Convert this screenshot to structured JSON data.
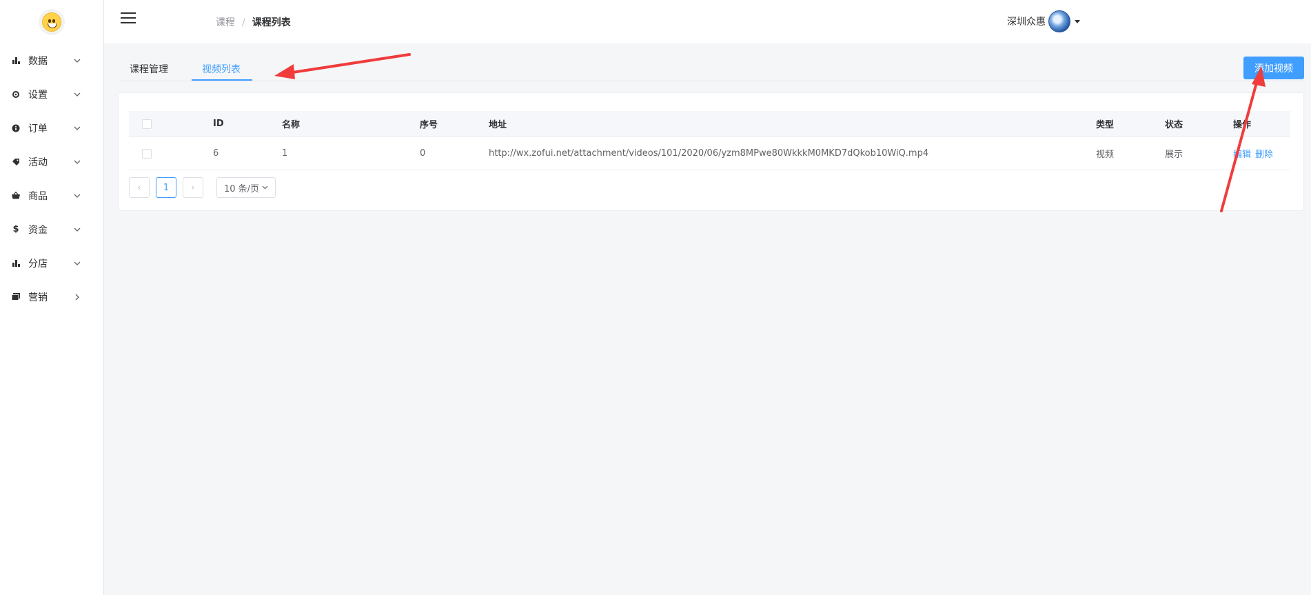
{
  "sidebar": {
    "items": [
      {
        "label": "数据",
        "icon": "bar-chart-icon",
        "arrow": "chevron-down-icon"
      },
      {
        "label": "设置",
        "icon": "gear-icon",
        "arrow": "chevron-down-icon"
      },
      {
        "label": "订单",
        "icon": "info-circle-icon",
        "arrow": "chevron-down-icon"
      },
      {
        "label": "活动",
        "icon": "tag-icon",
        "arrow": "chevron-down-icon"
      },
      {
        "label": "商品",
        "icon": "basket-icon",
        "arrow": "chevron-down-icon"
      },
      {
        "label": "资金",
        "icon": "dollar-icon",
        "arrow": "chevron-down-icon"
      },
      {
        "label": "分店",
        "icon": "bar-chart-icon",
        "arrow": "chevron-down-icon"
      },
      {
        "label": "营销",
        "icon": "stack-icon",
        "arrow": "chevron-right-icon"
      }
    ]
  },
  "header": {
    "breadcrumb": [
      "课程",
      "课程列表"
    ],
    "breadcrumb_separator": "/",
    "user_name": "深圳众惠"
  },
  "tabs": {
    "items": [
      "课程管理",
      "视频列表"
    ],
    "active_index": 1
  },
  "toolbar": {
    "add_video_label": "添加视频"
  },
  "table": {
    "columns": [
      "ID",
      "名称",
      "序号",
      "地址",
      "类型",
      "状态",
      "操作"
    ],
    "rows": [
      {
        "id": "6",
        "name": "1",
        "order": "0",
        "url": "http://wx.zofui.net/attachment/videos/101/2020/06/yzm8MPwe80WkkkM0MKD7dQkob10WiQ.mp4",
        "type": "视频",
        "status": "展示",
        "actions": {
          "edit": "编辑",
          "delete": "删除"
        }
      }
    ]
  },
  "pagination": {
    "current_page": "1",
    "page_size": "10 条/页",
    "prev_symbol": "‹",
    "next_symbol": "›"
  },
  "colors": {
    "primary": "#409eff",
    "annotation_arrow": "#f03c3c"
  }
}
